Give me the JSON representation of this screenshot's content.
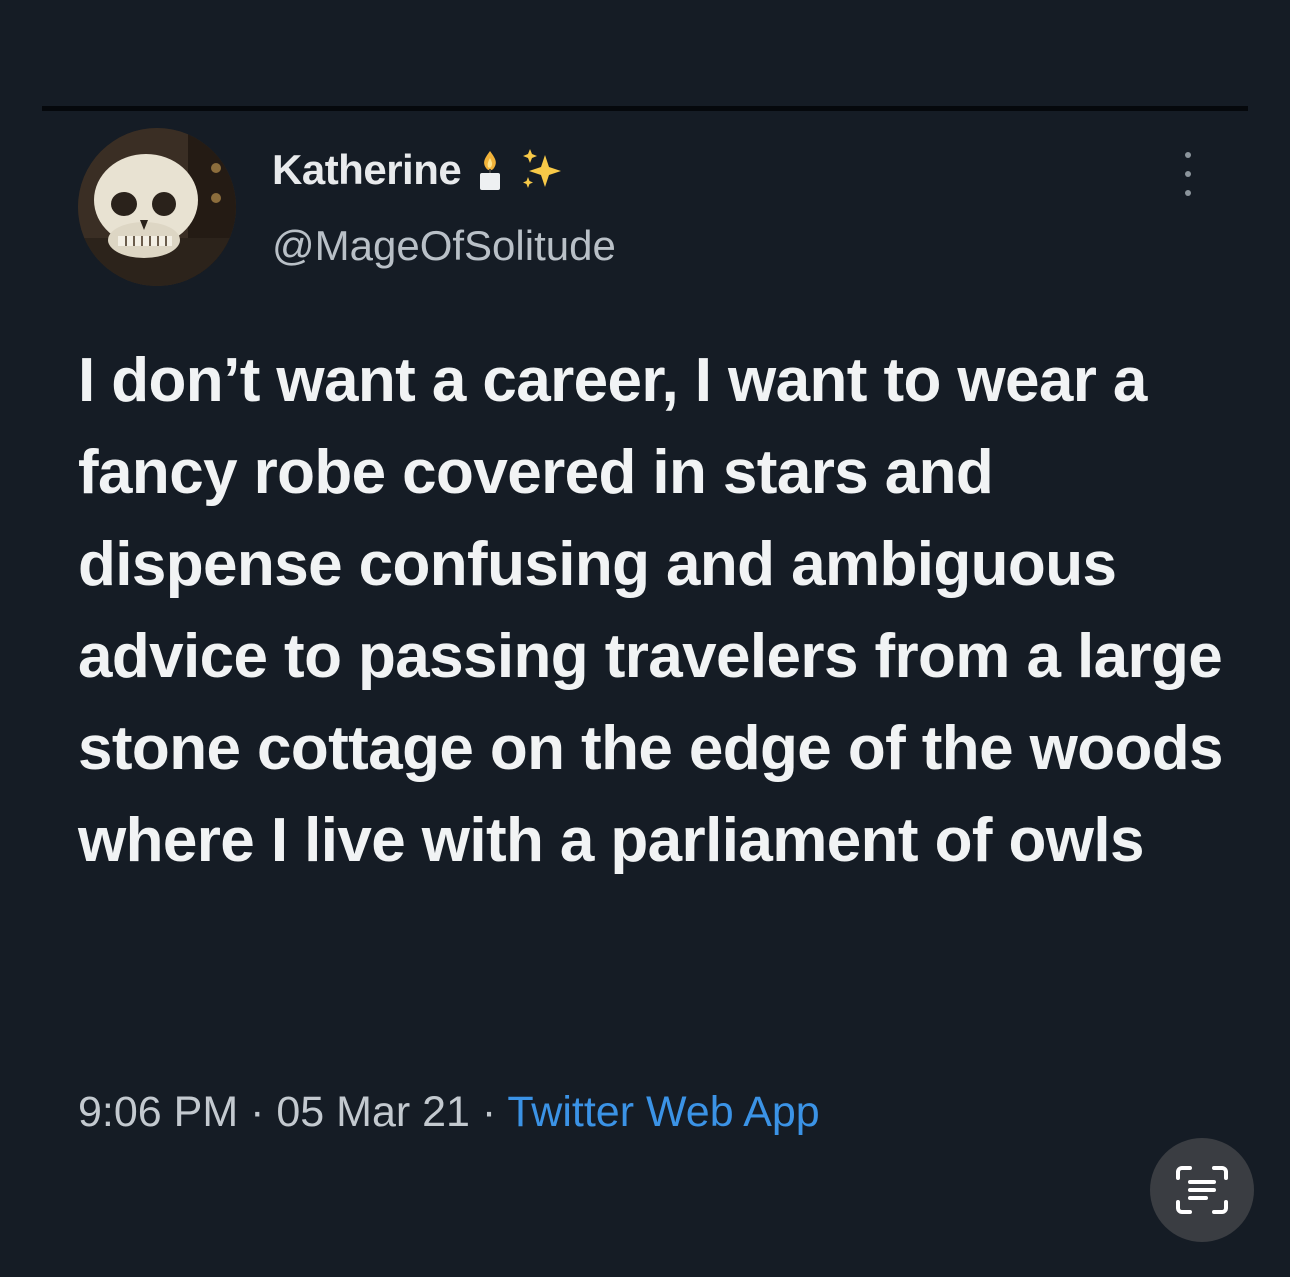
{
  "tweet": {
    "author": {
      "display_name": "Katherine",
      "name_emojis": [
        "candle-icon",
        "sparkles-icon"
      ],
      "handle": "@MageOfSolitude",
      "avatar": "skull-avatar"
    },
    "text": "I don’t want a career, I want to wear a fancy robe covered in stars and dispense confusing and ambiguous advice to passing travelers from a large stone cottage on the edge of the woods where I live with a parliament of owls",
    "time": "9:06 PM",
    "separator": " · ",
    "date": "05 Mar 21",
    "source": "Twitter Web App"
  },
  "overlay": {
    "text_scan_icon": "text-scan-icon"
  },
  "colors": {
    "background": "#151c25",
    "text": "#f1f3f4",
    "secondary_text": "#b9c0c7",
    "link": "#3b93e6"
  }
}
